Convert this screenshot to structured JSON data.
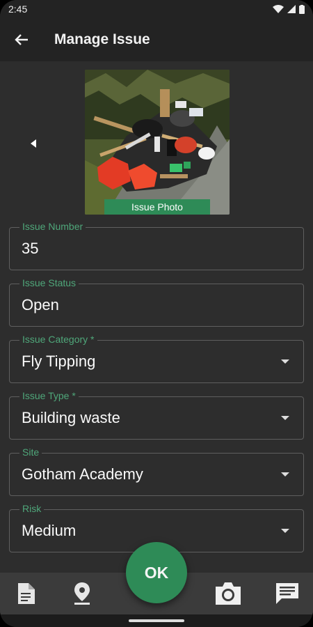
{
  "status_bar": {
    "time": "2:45"
  },
  "app_bar": {
    "title": "Manage Issue"
  },
  "photo": {
    "caption": "Issue Photo"
  },
  "fields": [
    {
      "label": "Issue Number",
      "value": "35",
      "dropdown": false
    },
    {
      "label": "Issue Status",
      "value": "Open",
      "dropdown": false
    },
    {
      "label": "Issue Category *",
      "value": "Fly Tipping",
      "dropdown": true
    },
    {
      "label": "Issue Type *",
      "value": "Building waste",
      "dropdown": true
    },
    {
      "label": "Site",
      "value": "Gotham Academy",
      "dropdown": true
    },
    {
      "label": "Risk",
      "value": "Medium",
      "dropdown": true
    }
  ],
  "fab": {
    "label": "OK"
  },
  "colors": {
    "accent": "#2e8b57",
    "label_green": "#4fa77a",
    "background": "#2d2d2d",
    "bar": "#232323"
  },
  "icons": [
    "back-arrow-icon",
    "wifi-icon",
    "signal-icon",
    "battery-icon",
    "prev-photo-icon",
    "document-icon",
    "location-pin-icon",
    "camera-icon",
    "message-icon"
  ]
}
